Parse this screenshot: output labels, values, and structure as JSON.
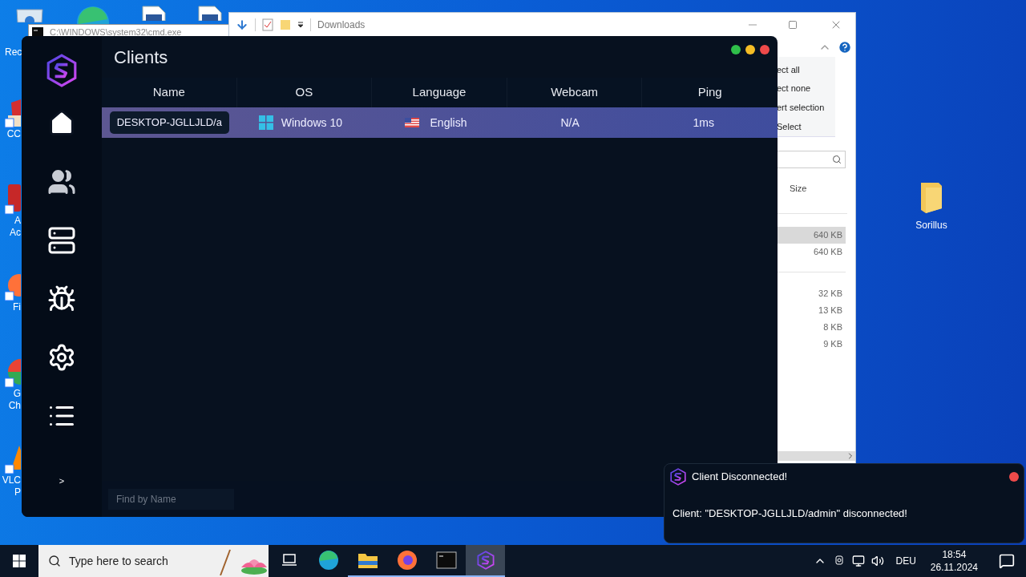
{
  "desktop": {
    "top_icons": [
      {
        "kind": "recycle",
        "label": "Rec"
      },
      {
        "kind": "edge"
      },
      {
        "kind": "document"
      },
      {
        "kind": "document"
      }
    ],
    "left_icons": [
      {
        "kind": "ccleaner",
        "lines": [
          "CC"
        ]
      },
      {
        "kind": "acrobat",
        "lines": [
          "A",
          "Ac"
        ]
      },
      {
        "kind": "firefox",
        "lines": [
          "Fi"
        ]
      },
      {
        "kind": "chrome",
        "lines": [
          "G",
          "Ch"
        ]
      },
      {
        "kind": "vlc",
        "lines": [
          "VLC",
          "P"
        ]
      }
    ],
    "folder": {
      "label": "Sorillus"
    }
  },
  "cmd_window": {
    "title": "C:\\WINDOWS\\system32\\cmd.exe"
  },
  "explorer": {
    "title": "Downloads",
    "ribbon_items": [
      "ect all",
      "ect none",
      "ert selection",
      "Select"
    ],
    "size_column": "Size",
    "groups": [
      [
        {
          "size": "640 KB",
          "selected": true
        },
        {
          "size": "640 KB",
          "selected": false
        }
      ],
      [
        {
          "size": "32 KB",
          "selected": false
        },
        {
          "size": "13 KB",
          "selected": false
        },
        {
          "size": "8 KB",
          "selected": false
        },
        {
          "size": "9 KB",
          "selected": false
        }
      ]
    ]
  },
  "app": {
    "title": "Clients",
    "nav": [
      {
        "kind": "home"
      },
      {
        "kind": "users"
      },
      {
        "kind": "server"
      },
      {
        "kind": "bug"
      },
      {
        "kind": "settings"
      },
      {
        "kind": "list"
      }
    ],
    "expand_label": ">",
    "columns": [
      "Name",
      "OS",
      "Language",
      "Webcam",
      "Ping"
    ],
    "rows": [
      {
        "name": "DESKTOP-JGLLJLD/a",
        "os": "Windows 10",
        "language": "English",
        "webcam": "N/A",
        "ping": "1ms",
        "selected": true
      }
    ],
    "search": {
      "placeholder": "Find by Name"
    }
  },
  "notification": {
    "title": "Client Disconnected!",
    "message": "Client: \"DESKTOP-JGLLJLD/admin\" disconnected!"
  },
  "taskbar": {
    "search": {
      "placeholder": "Type here to search"
    },
    "apps": [
      {
        "kind": "taskview",
        "running": false,
        "selected": false
      },
      {
        "kind": "edge",
        "running": false,
        "selected": false
      },
      {
        "kind": "explorer",
        "running": true,
        "selected": false
      },
      {
        "kind": "firefox",
        "running": true,
        "selected": false
      },
      {
        "kind": "cmd",
        "running": true,
        "selected": false
      },
      {
        "kind": "sorillus",
        "running": true,
        "selected": true
      }
    ],
    "language": "DEU",
    "time": "18:54",
    "date": "26.11.2024"
  }
}
